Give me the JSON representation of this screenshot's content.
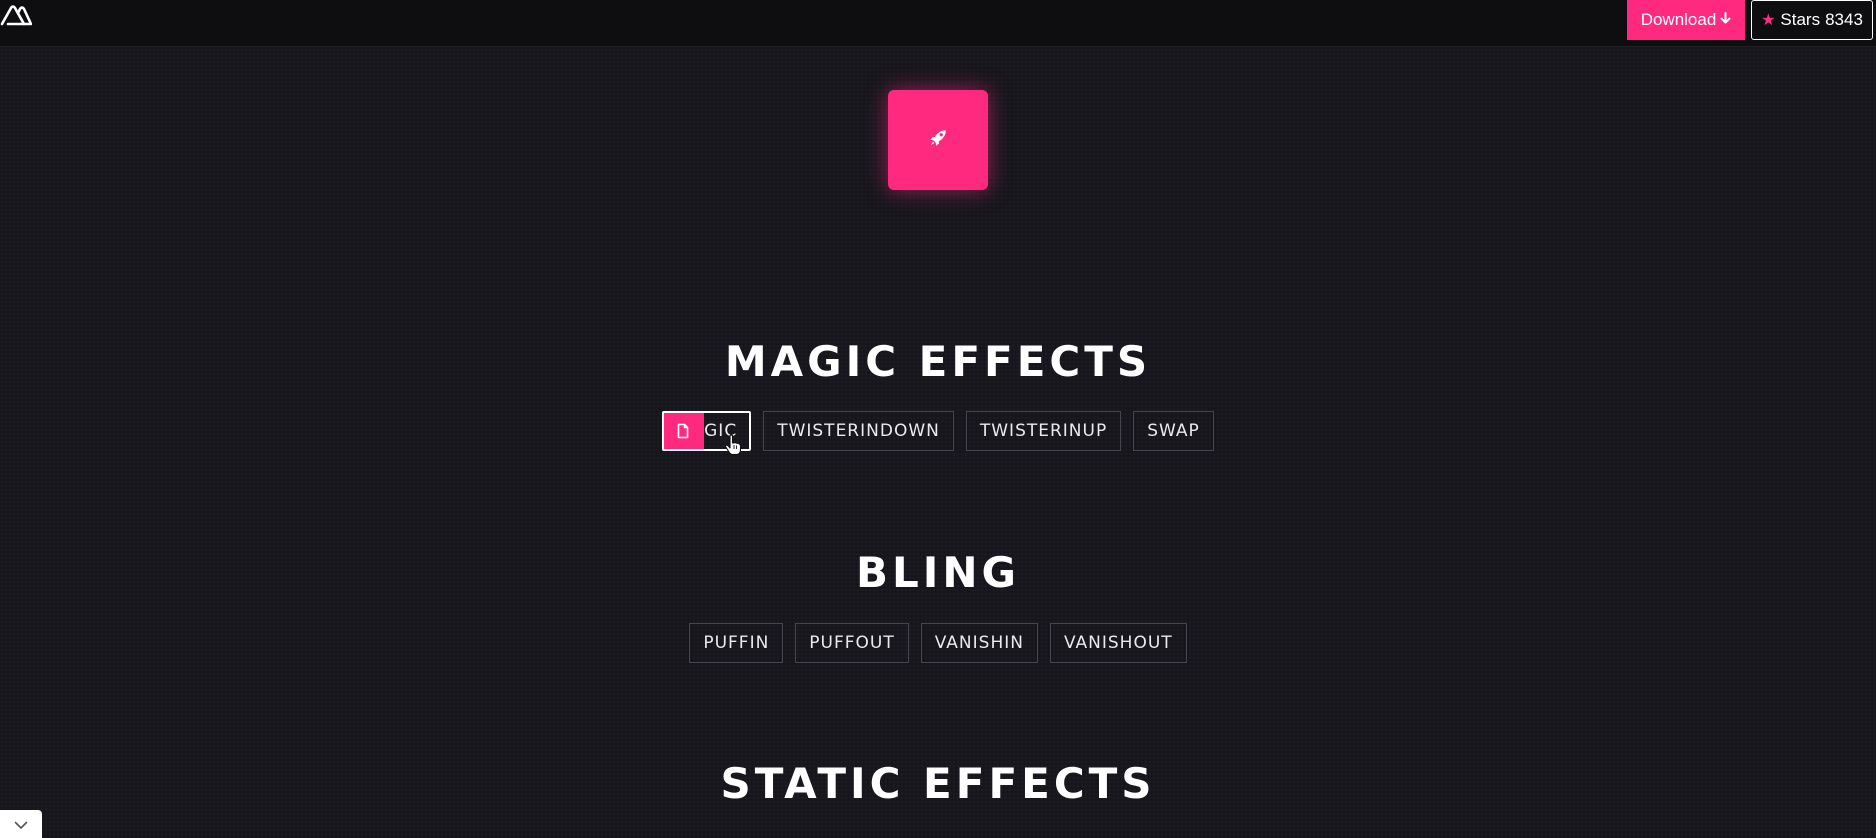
{
  "header": {
    "download_label": "Download",
    "stars_label": "Stars",
    "stars_count": "8343"
  },
  "sections": [
    {
      "title": "MAGIC EFFECTS",
      "buttons": [
        "MAGIC",
        "TWISTERINDOWN",
        "TWISTERINUP",
        "SWAP"
      ]
    },
    {
      "title": "BLING",
      "buttons": [
        "PUFFIN",
        "PUFFOUT",
        "VANISHIN",
        "VANISHOUT"
      ]
    },
    {
      "title": "STATIC EFFECTS"
    }
  ],
  "active_button_partial_text": "AGIC",
  "colors": {
    "accent": "#ff2a7f",
    "background": "#17161c",
    "topbar": "#0e0e11",
    "button_border": "#45444d"
  },
  "icons": {
    "logo": "triangle-logo-icon",
    "download": "arrow-down-icon",
    "star": "star-icon",
    "hero": "rocket-icon",
    "active_overlay": "file-icon",
    "cursor": "hand-pointer-icon",
    "corner": "chevron-down-icon"
  }
}
